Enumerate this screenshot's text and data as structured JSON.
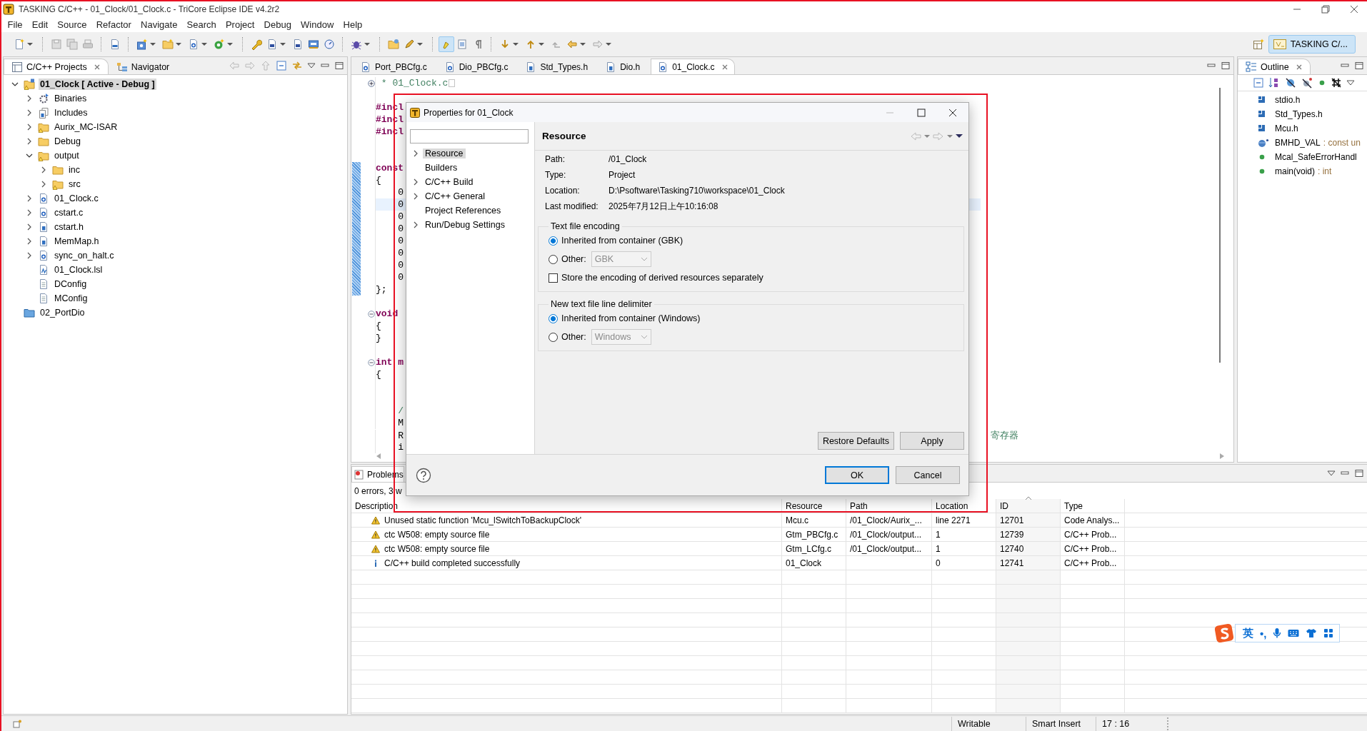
{
  "window": {
    "title": "TASKING C/C++ - 01_Clock/01_Clock.c - TriCore Eclipse IDE v4.2r2"
  },
  "menu": [
    "File",
    "Edit",
    "Source",
    "Refactor",
    "Navigate",
    "Search",
    "Project",
    "Debug",
    "Window",
    "Help"
  ],
  "toolbar": [
    {
      "kind": "new",
      "dropdown": true,
      "separator_before": false
    },
    {
      "kind": "save",
      "dropdown": false,
      "separator_before": true
    },
    {
      "kind": "save_all",
      "dropdown": false,
      "separator_before": false
    },
    {
      "kind": "print",
      "dropdown": false,
      "separator_before": false
    },
    {
      "kind": "binary",
      "dropdown": false,
      "separator_before": true
    },
    {
      "kind": "new_project",
      "dropdown": true,
      "separator_before": true
    },
    {
      "kind": "new_folder",
      "dropdown": true,
      "separator_before": false
    },
    {
      "kind": "new_source",
      "dropdown": true,
      "separator_before": false
    },
    {
      "kind": "run",
      "dropdown": true,
      "separator_before": false
    },
    {
      "kind": "wrench",
      "dropdown": false,
      "separator_before": true
    },
    {
      "kind": "hex",
      "dropdown": true,
      "separator_before": false
    },
    {
      "kind": "hex",
      "dropdown": false,
      "separator_before": false
    },
    {
      "kind": "hex_flash",
      "dropdown": false,
      "separator_before": false
    },
    {
      "kind": "gauge",
      "dropdown": false,
      "separator_before": false
    },
    {
      "kind": "debug",
      "dropdown": true,
      "separator_before": true
    },
    {
      "kind": "open_folder",
      "dropdown": false,
      "separator_before": true
    },
    {
      "kind": "pencil",
      "dropdown": true,
      "separator_before": false
    },
    {
      "kind": "highlight",
      "dropdown": false,
      "separator_before": true,
      "pressed": true
    },
    {
      "kind": "block",
      "dropdown": false,
      "separator_before": false,
      "pressed": false
    },
    {
      "kind": "whitespace",
      "dropdown": false,
      "separator_before": false,
      "pressed": false
    },
    {
      "kind": "next_annotation",
      "dropdown": true,
      "separator_before": true
    },
    {
      "kind": "prev_annotation",
      "dropdown": true,
      "separator_before": false
    },
    {
      "kind": "last_edit",
      "dropdown": false,
      "separator_before": false
    },
    {
      "kind": "back",
      "dropdown": true,
      "separator_before": false
    },
    {
      "kind": "forward",
      "dropdown": true,
      "separator_before": false
    }
  ],
  "perspective": {
    "label": "TASKING C/...",
    "selected": true
  },
  "projects_view": {
    "tabs": [
      {
        "label": "C/C++ Projects",
        "selected": true
      },
      {
        "label": "Navigator",
        "selected": false
      }
    ],
    "tree": [
      {
        "label": "01_Clock [ Active - Debug ]",
        "kind": "project",
        "expanded": true,
        "selected": true,
        "children": [
          {
            "label": "Binaries",
            "kind": "binaries",
            "expanded": false,
            "selected": false
          },
          {
            "label": "Includes",
            "kind": "includes",
            "expanded": false,
            "selected": false
          },
          {
            "label": "Aurix_MC-ISAR",
            "kind": "folder_warn",
            "expanded": false,
            "selected": false
          },
          {
            "label": "Debug",
            "kind": "folder",
            "expanded": false,
            "selected": false
          },
          {
            "label": "output",
            "kind": "folder_warn",
            "expanded": true,
            "selected": false,
            "children": [
              {
                "label": "inc",
                "kind": "folder",
                "expanded": false,
                "selected": false
              },
              {
                "label": "src",
                "kind": "folder_warn",
                "expanded": false,
                "selected": false
              }
            ]
          },
          {
            "label": "01_Clock.c",
            "kind": "c_file",
            "expanded": false,
            "selected": false
          },
          {
            "label": "cstart.c",
            "kind": "c_file",
            "expanded": false,
            "selected": false
          },
          {
            "label": "cstart.h",
            "kind": "h_file",
            "expanded": false,
            "selected": false
          },
          {
            "label": "MemMap.h",
            "kind": "h_file",
            "expanded": false,
            "selected": false
          },
          {
            "label": "sync_on_halt.c",
            "kind": "c_file",
            "expanded": false,
            "selected": false
          },
          {
            "label": "01_Clock.lsl",
            "kind": "lsl_file",
            "selected": false
          },
          {
            "label": "DConfig",
            "kind": "text_file",
            "selected": false
          },
          {
            "label": "MConfig",
            "kind": "text_file",
            "selected": false
          }
        ]
      },
      {
        "label": "02_PortDio",
        "kind": "closed_project",
        "selected": false
      }
    ]
  },
  "editor": {
    "tabs": [
      {
        "label": "Port_PBCfg.c",
        "kind": "c_file",
        "selected": false
      },
      {
        "label": "Dio_PBCfg.c",
        "kind": "c_file",
        "selected": false
      },
      {
        "label": "Std_Types.h",
        "kind": "h_file",
        "selected": false
      },
      {
        "label": "Dio.h",
        "kind": "h_file",
        "selected": false
      },
      {
        "label": "01_Clock.c",
        "kind": "c_file",
        "selected": true
      }
    ],
    "lines": [
      {
        "text": " * 01_Clock.c",
        "kind": "comment",
        "folded": true,
        "changed": false,
        "current": false
      },
      {
        "kind": "blank",
        "changed": false,
        "current": false
      },
      {
        "text": "#incl",
        "kind": "directive",
        "changed": false,
        "current": false
      },
      {
        "text": "#incl",
        "kind": "directive",
        "changed": false,
        "current": false
      },
      {
        "text": "#incl",
        "kind": "directive",
        "changed": false,
        "current": false
      },
      {
        "kind": "blank",
        "changed": false,
        "current": false
      },
      {
        "kind": "blank",
        "changed": false,
        "current": false
      },
      {
        "text": "const",
        "kind": "keyword",
        "changed": true,
        "current": false
      },
      {
        "text": "{",
        "kind": "plain",
        "changed": true,
        "current": false
      },
      {
        "text": "    0",
        "kind": "plain",
        "changed": true,
        "current": false
      },
      {
        "text": "    0",
        "kind": "plain",
        "changed": true,
        "current": true
      },
      {
        "text": "    0",
        "kind": "plain",
        "changed": true,
        "current": false
      },
      {
        "text": "    0",
        "kind": "plain",
        "changed": true,
        "current": false
      },
      {
        "text": "    0",
        "kind": "plain",
        "changed": true,
        "current": false
      },
      {
        "text": "    0",
        "kind": "plain",
        "changed": true,
        "current": false
      },
      {
        "text": "    0",
        "kind": "plain",
        "changed": true,
        "current": false
      },
      {
        "text": "    0",
        "kind": "plain",
        "changed": true,
        "current": false
      },
      {
        "text": "};",
        "kind": "plain",
        "changed": true,
        "current": false
      },
      {
        "kind": "blank",
        "changed": false,
        "current": false
      },
      {
        "text": "void",
        "kind": "keyword",
        "folded": false,
        "changed": false,
        "current": false
      },
      {
        "text": "{",
        "kind": "plain",
        "changed": false,
        "current": false
      },
      {
        "text": "}",
        "kind": "plain",
        "changed": false,
        "current": false
      },
      {
        "kind": "blank",
        "changed": false,
        "current": false
      },
      {
        "text": "int m",
        "kind": "keyword",
        "folded": false,
        "changed": false,
        "current": false
      },
      {
        "text": "{",
        "kind": "plain",
        "changed": false,
        "current": false
      },
      {
        "kind": "blank",
        "changed": false,
        "current": false
      },
      {
        "kind": "blank",
        "changed": false,
        "current": false
      },
      {
        "text": "    /",
        "kind": "comment",
        "changed": false,
        "current": false
      },
      {
        "text": "    M",
        "kind": "plain",
        "changed": false,
        "current": false
      },
      {
        "text": "    R",
        "kind": "plain",
        "note": "寄存器",
        "changed": false,
        "current": false
      },
      {
        "text": "    i",
        "kind": "plain",
        "changed": false,
        "current": false
      }
    ]
  },
  "outline": {
    "tab": {
      "label": "Outline",
      "selected": true
    },
    "items": [
      {
        "label": "stdio.h",
        "kind": "include"
      },
      {
        "label": "Std_Types.h",
        "kind": "include"
      },
      {
        "label": "Mcu.h",
        "kind": "include"
      },
      {
        "label": "BMHD_VAL",
        "type": ": const un",
        "kind": "constant"
      },
      {
        "label": "Mcal_SafeErrorHandl",
        "kind": "function"
      },
      {
        "label": "main(void)",
        "type": ": int",
        "kind": "function"
      }
    ]
  },
  "problems": {
    "tab": {
      "label": "Problems",
      "selected": true
    },
    "summary": "0 errors, 3 w",
    "columns": [
      {
        "label": "Description",
        "sorted": false
      },
      {
        "label": "Resource",
        "sorted": false
      },
      {
        "label": "Path",
        "sorted": false
      },
      {
        "label": "Location",
        "sorted": false
      },
      {
        "label": "ID",
        "sorted": true
      },
      {
        "label": "Type",
        "sorted": false
      }
    ],
    "rows": [
      {
        "kind": "warning",
        "cells": [
          "Unused static function 'Mcu_lSwitchToBackupClock'",
          "Mcu.c",
          "/01_Clock/Aurix_...",
          "line 2271",
          "12701",
          "Code Analys..."
        ]
      },
      {
        "kind": "warning",
        "cells": [
          "ctc W508: empty source file",
          "Gtm_PBCfg.c",
          "/01_Clock/output...",
          "1",
          "12739",
          "C/C++ Prob..."
        ]
      },
      {
        "kind": "warning",
        "cells": [
          "ctc W508: empty source file",
          "Gtm_LCfg.c",
          "/01_Clock/output...",
          "1",
          "12740",
          "C/C++ Prob..."
        ]
      },
      {
        "kind": "info",
        "cells": [
          "C/C++ build completed successfully",
          "01_Clock",
          null,
          "0",
          "12741",
          "C/C++ Prob..."
        ]
      }
    ]
  },
  "status_bar": {
    "items": [
      "Writable",
      "Smart Insert",
      "17 : 16"
    ]
  },
  "dialog": {
    "title": "Properties for 01_Clock",
    "nav": [
      {
        "label": "Resource",
        "expanded": false,
        "selected": true
      },
      {
        "label": "Builders",
        "selected": false
      },
      {
        "label": "C/C++ Build",
        "expanded": false,
        "selected": false
      },
      {
        "label": "C/C++ General",
        "expanded": false,
        "selected": false
      },
      {
        "label": "Project References",
        "selected": false
      },
      {
        "label": "Run/Debug Settings",
        "expanded": false,
        "selected": false
      }
    ],
    "page_title": "Resource",
    "info": [
      {
        "label": "Path:",
        "value": "/01_Clock"
      },
      {
        "label": "Type:",
        "value": "Project"
      },
      {
        "label": "Location:",
        "value": "D:\\Psoftware\\Tasking710\\workspace\\01_Clock"
      },
      {
        "label": "Last modified:",
        "value": "2025年7月12日上午10:16:08"
      }
    ],
    "groups": [
      {
        "title": "Text file encoding",
        "options": [
          {
            "kind": "radio",
            "label": "Inherited from container (GBK)",
            "selected": true
          },
          {
            "kind": "radio_combo",
            "label": "Other:",
            "selected": false,
            "value": "GBK",
            "disabled": true
          },
          {
            "kind": "checkbox",
            "label": "Store the encoding of derived resources separately",
            "checked": false
          }
        ]
      },
      {
        "title": "New text file line delimiter",
        "options": [
          {
            "kind": "radio",
            "label": "Inherited from container (Windows)",
            "selected": true
          },
          {
            "kind": "radio_combo",
            "label": "Other:",
            "selected": false,
            "value": "Windows",
            "disabled": true
          }
        ]
      }
    ],
    "page_buttons": [
      "Restore Defaults",
      "Apply"
    ],
    "buttons": [
      {
        "label": "OK",
        "default": true
      },
      {
        "label": "Cancel",
        "default": false
      }
    ]
  },
  "ime": {
    "mode": "英",
    "punctuation": "•,"
  }
}
